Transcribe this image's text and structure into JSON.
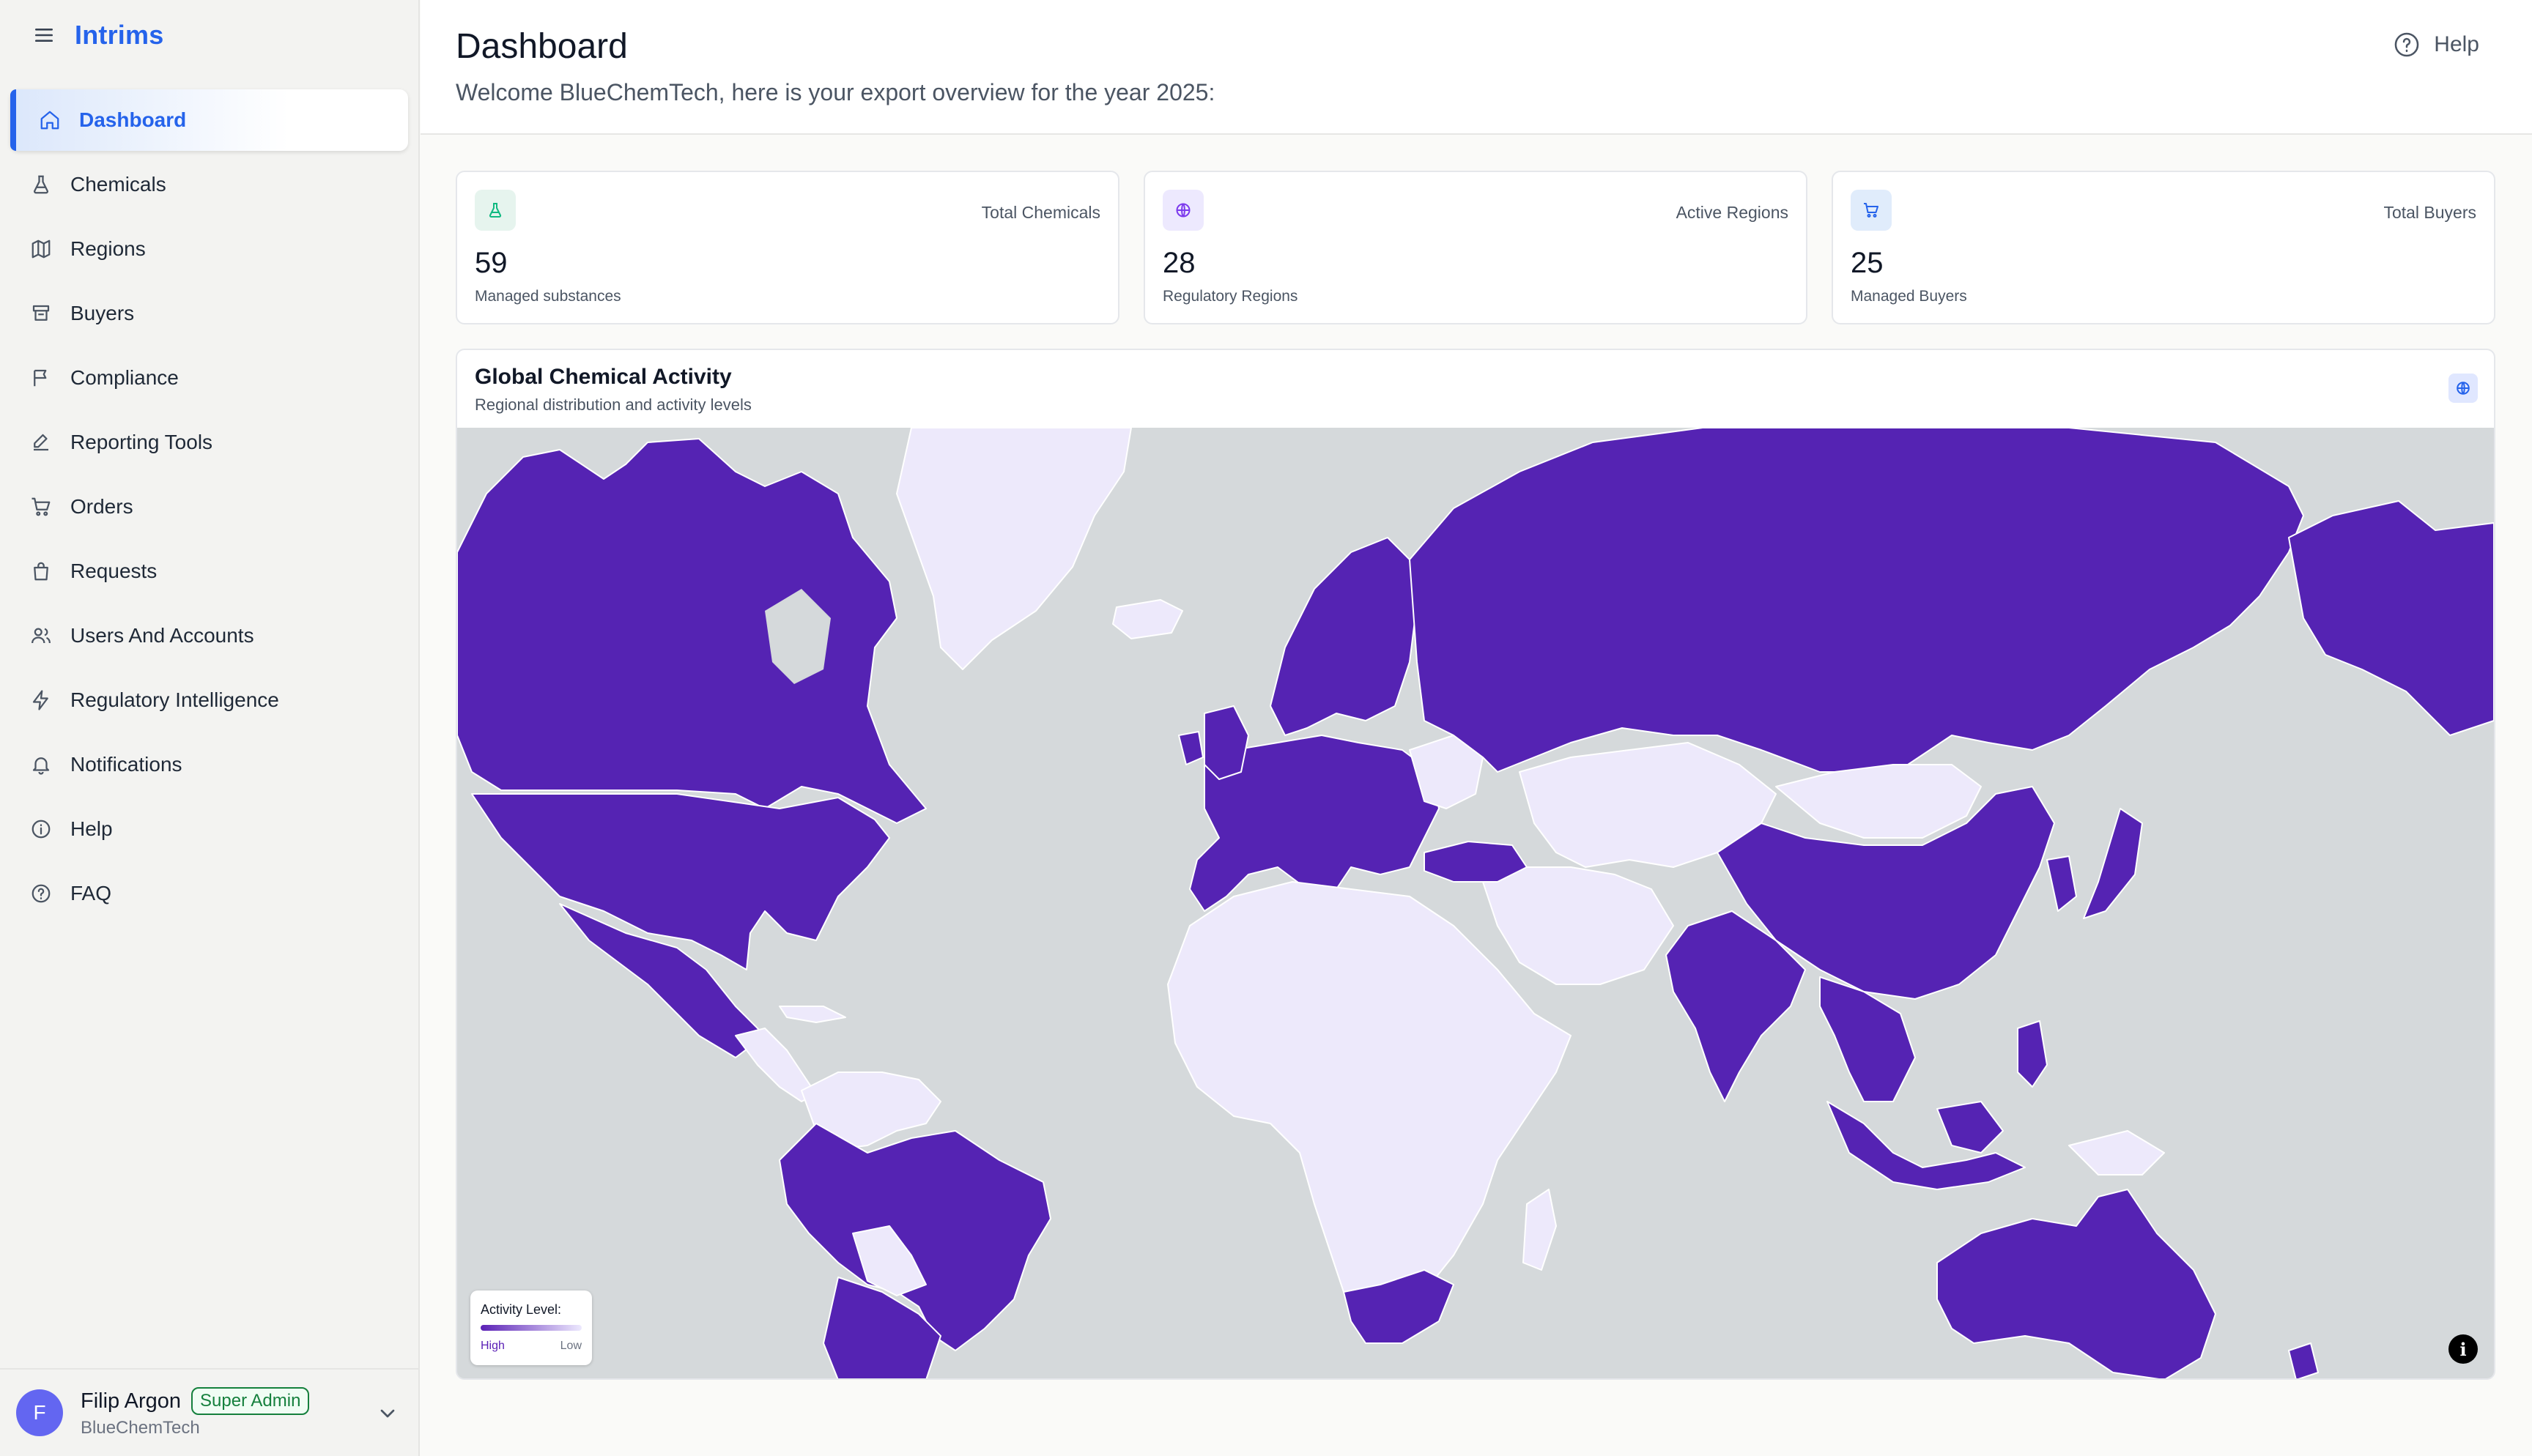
{
  "app": {
    "name": "Intrims"
  },
  "sidebar": {
    "items": [
      {
        "label": "Dashboard",
        "icon": "home-icon",
        "active": true
      },
      {
        "label": "Chemicals",
        "icon": "flask-icon"
      },
      {
        "label": "Regions",
        "icon": "map-icon"
      },
      {
        "label": "Buyers",
        "icon": "cart-icon"
      },
      {
        "label": "Compliance",
        "icon": "flag-icon"
      },
      {
        "label": "Reporting Tools",
        "icon": "edit-icon"
      },
      {
        "label": "Orders",
        "icon": "cart-icon"
      },
      {
        "label": "Requests",
        "icon": "bag-icon"
      },
      {
        "label": "Users And Accounts",
        "icon": "users-icon"
      },
      {
        "label": "Regulatory Intelligence",
        "icon": "bolt-icon"
      },
      {
        "label": "Notifications",
        "icon": "bell-icon"
      },
      {
        "label": "Help",
        "icon": "info-icon"
      },
      {
        "label": "FAQ",
        "icon": "help-circle-icon"
      }
    ],
    "user": {
      "initial": "F",
      "name": "Filip Argon",
      "role": "Super Admin",
      "org": "BlueChemTech"
    }
  },
  "header": {
    "title": "Dashboard",
    "subtitle": "Welcome BlueChemTech, here is your export overview for the year 2025:",
    "help_label": "Help"
  },
  "stats": [
    {
      "label": "Total Chemicals",
      "value": "59",
      "description": "Managed substances",
      "icon": "flask-icon",
      "icon_bg": "#e6f4ee"
    },
    {
      "label": "Active Regions",
      "value": "28",
      "description": "Regulatory Regions",
      "icon": "globe-icon",
      "icon_bg": "#ede9fe"
    },
    {
      "label": "Total Buyers",
      "value": "25",
      "description": "Managed Buyers",
      "icon": "cart-icon",
      "icon_bg": "#e0ecfb"
    }
  ],
  "map": {
    "title": "Global Chemical Activity",
    "subtitle": "Regional distribution and activity levels",
    "legend": {
      "title": "Activity Level:",
      "high": "High",
      "low": "Low"
    },
    "colors": {
      "high": "#5523b3",
      "low": "#ede9fb",
      "water": "#d5d9db"
    }
  }
}
